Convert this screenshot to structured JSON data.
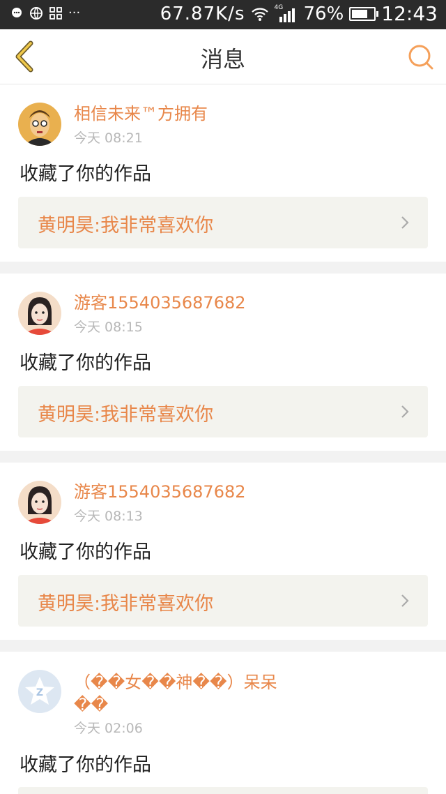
{
  "status_bar": {
    "speed": "67.87K/s",
    "network": "4G",
    "battery": "76%",
    "battery_level": 0.76,
    "time": "12:43",
    "left_icons": [
      "message-icon",
      "globe-icon",
      "app-grid-icon",
      "more-dots-icon"
    ]
  },
  "header": {
    "title": "消息",
    "back_icon": "chevron-left-icon",
    "search_icon": "search-icon",
    "accent_color": "#f5a05a"
  },
  "messages": [
    {
      "user": "相信未来™方拥有",
      "time": "今天 08:21",
      "action": "收藏了你的作品",
      "quote": "黄明昊:我非常喜欢你",
      "avatar": "cartoon-avatar"
    },
    {
      "user": "游客1554035687682",
      "time": "今天 08:15",
      "action": "收藏了你的作品",
      "quote": "黄明昊:我非常喜欢你",
      "avatar": "girl-avatar"
    },
    {
      "user": "游客1554035687682",
      "time": "今天 08:13",
      "action": "收藏了你的作品",
      "quote": "黄明昊:我非常喜欢你",
      "avatar": "girl-avatar"
    },
    {
      "user": "（��女��神��）呆呆��",
      "time": "今天 02:06",
      "action": "收藏了你的作品",
      "avatar": "default-qq-avatar"
    }
  ]
}
